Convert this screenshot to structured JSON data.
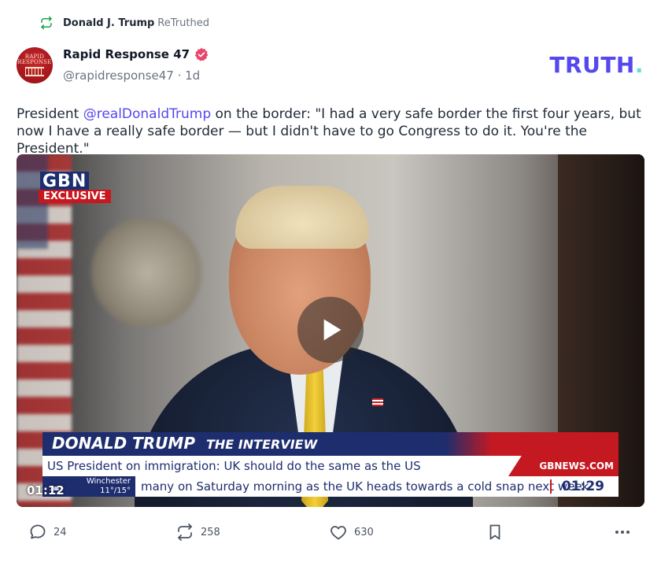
{
  "retruth": {
    "author": "Donald J. Trump",
    "verb": "ReTruthed"
  },
  "account": {
    "name": "Rapid Response 47",
    "handle": "@rapidresponse47",
    "separator": " · ",
    "time": "1d",
    "avatar_text": "RAPID\nRESPONSE"
  },
  "brand": {
    "logo_text": "TRUTH",
    "logo_dot": ".",
    "accent": "#5448ee",
    "dot_color": "#5de0d7"
  },
  "post": {
    "prefix": "President ",
    "mention": "@realDonaldTrump",
    "body": " on the border: \"I had a very safe border the first four years, but now I have a really safe border — but I didn't have to go Congress to do it. You're the President.\""
  },
  "video": {
    "channel": "GBN",
    "badge": "EXCLUSIVE",
    "headline_name": "DONALD TRUMP",
    "headline_title": "THE INTERVIEW",
    "subtitle": "US President on immigration: UK should do the same as the US",
    "site": "GBNEWS.COM",
    "weather_city": "Winchester",
    "weather_temp": "11°/15°",
    "scroll_text": "many on Saturday morning as the UK heads towards a cold snap next week",
    "clock": "01:29",
    "elapsed": "01:12",
    "play_icon": "play-icon"
  },
  "actions": {
    "replies": "24",
    "retruths": "258",
    "likes": "630"
  }
}
